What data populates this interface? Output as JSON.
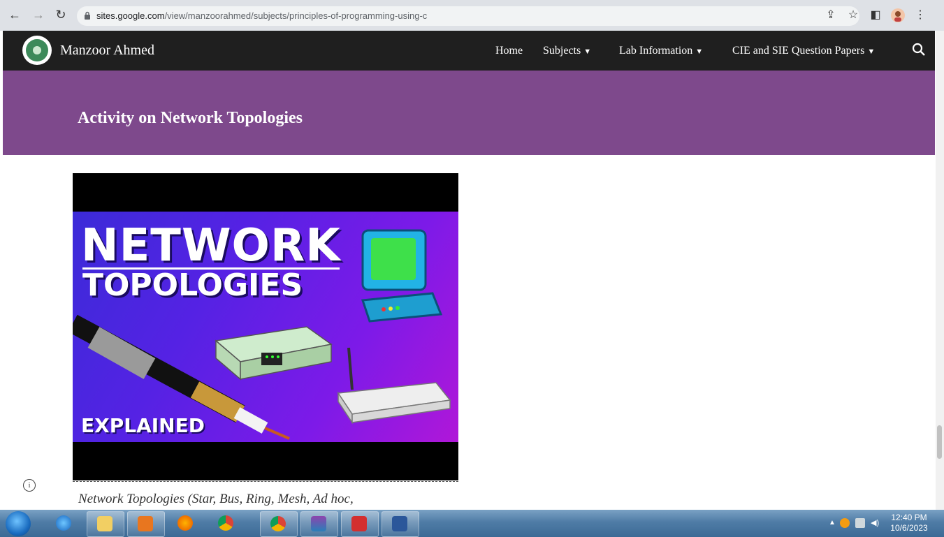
{
  "browser": {
    "url_host": "sites.google.com",
    "url_path": "/view/manzoorahmed/subjects/principles-of-programming-using-c"
  },
  "site": {
    "title": "Manzoor Ahmed",
    "nav": [
      {
        "label": "Home"
      },
      {
        "label": "Subjects"
      },
      {
        "label": "Lab Information"
      },
      {
        "label": "CIE and SIE Question Papers"
      }
    ]
  },
  "banner": {
    "title": "Activity on Network Topologies"
  },
  "video": {
    "thumb_line1": "NETWORK",
    "thumb_line2": "TOPOLOGIES",
    "thumb_line3": "EXPLAINED",
    "caption": "Network Topologies (Star, Bus, Ring, Mesh, Ad hoc,"
  },
  "taskbar": {
    "time": "12:40 PM",
    "date": "10/6/2023"
  },
  "colors": {
    "banner": "#7e498c",
    "header": "#1f1f1f"
  }
}
